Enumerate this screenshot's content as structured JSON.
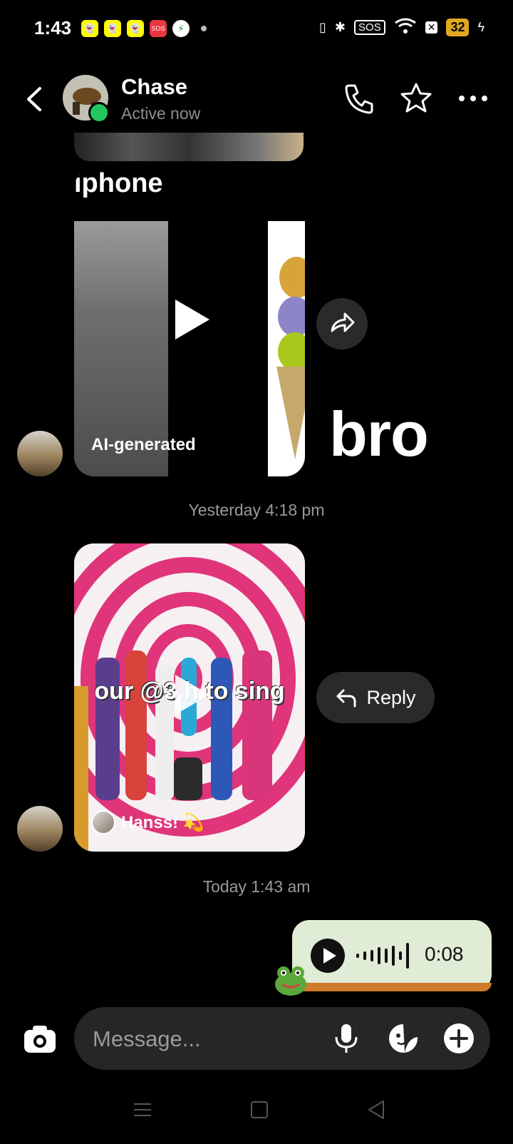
{
  "status_bar": {
    "time": "1:43",
    "notification_icons": [
      "snapchat-icon",
      "snapchat-icon",
      "snapchat-icon",
      "sos-icon",
      "messenger-icon"
    ],
    "sos_label": "SOS",
    "battery_level": "32",
    "accent_colors": {
      "snapchat": "#fffc00",
      "sos": "#e8353f",
      "battery": "#e0a821"
    }
  },
  "header": {
    "contact_name": "Chase",
    "presence": "Active now",
    "icons": [
      "back-arrow-icon",
      "phone-icon",
      "star-icon",
      "more-options-icon"
    ],
    "online_color": "#23c55e"
  },
  "messages": {
    "video1": {
      "title_text": "iphone",
      "label": "AI-generated"
    },
    "bro_text": "bro",
    "timestamp_1": "Yesterday 4:18 pm",
    "video2": {
      "caption": "our @3 h  to sing",
      "author": "Hanss! 💫"
    },
    "reply_label": "Reply",
    "timestamp_2": "Today 1:43 am",
    "voice_message": {
      "duration": "0:08",
      "background_color": "#e1ecd6"
    }
  },
  "composer": {
    "placeholder": "Message...",
    "icons": [
      "camera-icon",
      "microphone-icon",
      "sticker-icon",
      "plus-icon"
    ]
  },
  "nav_bar": {
    "icons": [
      "menu-icon",
      "home-icon",
      "back-icon"
    ]
  }
}
